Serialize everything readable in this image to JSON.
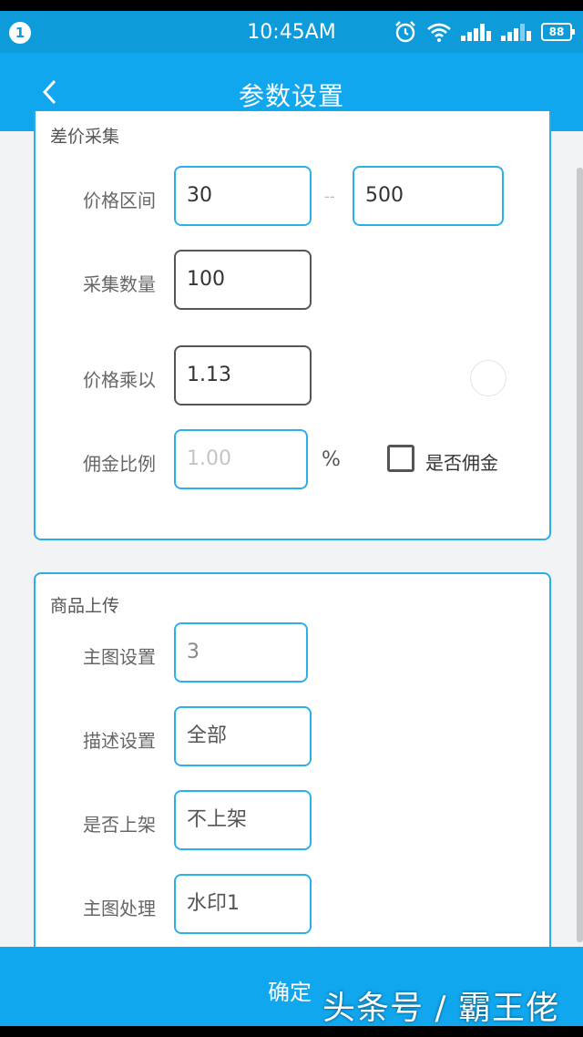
{
  "status_bar": {
    "notification_count": "1",
    "time": "10:45AM",
    "battery": "88",
    "icons": [
      "alarm-icon",
      "wifi-icon",
      "signal-icon",
      "signal-icon"
    ]
  },
  "header": {
    "title": "参数设置",
    "back_icon": "chevron-left-icon"
  },
  "price_section": {
    "title": "差价采集",
    "price_range": {
      "label": "价格区间",
      "min": "30",
      "separator": "--",
      "max": "500"
    },
    "quantity": {
      "label": "采集数量",
      "value": "100"
    },
    "multiplier": {
      "label": "价格乘以",
      "value": "1.13"
    },
    "commission": {
      "label": "佣金比例",
      "placeholder": "1.00",
      "unit": "%",
      "checkbox_label": "是否佣金",
      "checked": false
    }
  },
  "upload_section": {
    "title": "商品上传",
    "main_image": {
      "label": "主图设置",
      "value": "3"
    },
    "description": {
      "label": "描述设置",
      "value": "全部"
    },
    "listing": {
      "label": "是否上架",
      "value": "不上架"
    },
    "image_processing": {
      "label": "主图处理",
      "value": "水印1"
    }
  },
  "footer": {
    "confirm_label": "确定",
    "watermark": "头条号 / 霸王佬"
  },
  "colors": {
    "accent": "#10a7ee",
    "border": "#29aee8",
    "background": "#f2f3f5"
  }
}
